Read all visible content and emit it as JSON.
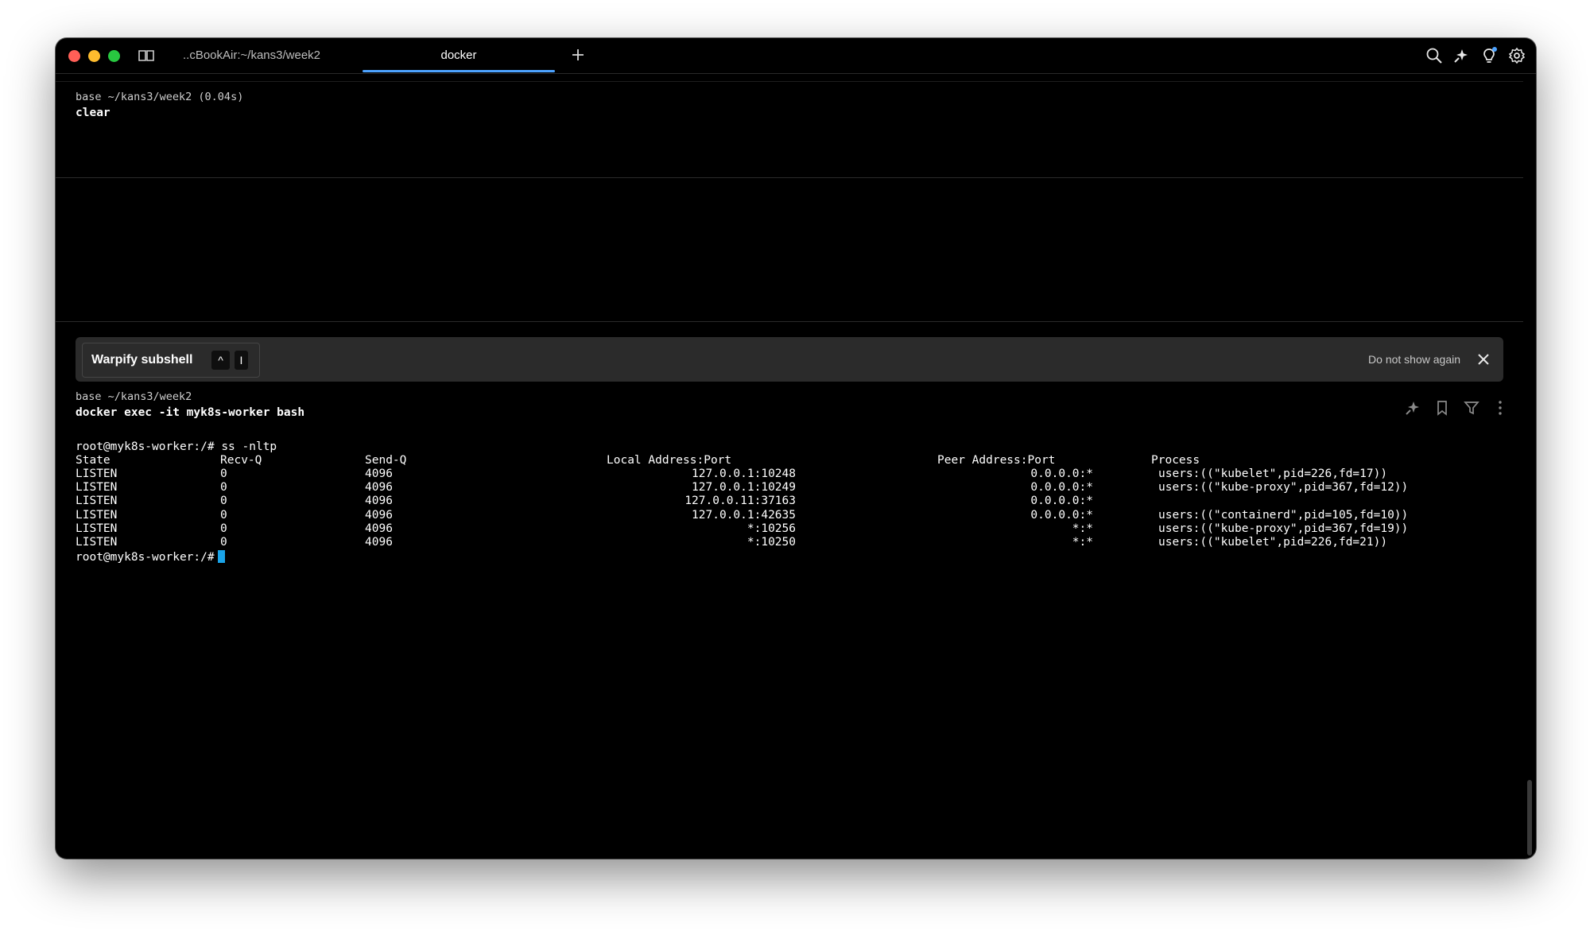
{
  "titlebar": {
    "tab1_label": "..cBookAir:~/kans3/week2",
    "tab2_label": "docker",
    "notification_color": "#4da3ff"
  },
  "block1": {
    "dir": "base ~/kans3/week2 (0.04s)",
    "command": "clear"
  },
  "banner": {
    "title": "Warpify subshell",
    "key1": "^",
    "key2": "I",
    "dismiss": "Do not show again"
  },
  "block2": {
    "dir": "base ~/kans3/week2",
    "command": "docker exec -it myk8s-worker bash"
  },
  "terminal": {
    "prompt_cmd": "root@myk8s-worker:/# ss -nltp",
    "prompt": "root@myk8s-worker:/#",
    "headers": [
      "State",
      "Recv-Q",
      "Send-Q",
      "Local Address:Port",
      "Peer Address:Port",
      "Process"
    ],
    "rows": [
      [
        "LISTEN",
        "0",
        "4096",
        "127.0.0.1:10248",
        "0.0.0.0:*",
        "users:((\"kubelet\",pid=226,fd=17))"
      ],
      [
        "LISTEN",
        "0",
        "4096",
        "127.0.0.1:10249",
        "0.0.0.0:*",
        "users:((\"kube-proxy\",pid=367,fd=12))"
      ],
      [
        "LISTEN",
        "0",
        "4096",
        "127.0.0.11:37163",
        "0.0.0.0:*",
        ""
      ],
      [
        "LISTEN",
        "0",
        "4096",
        "127.0.0.1:42635",
        "0.0.0.0:*",
        "users:((\"containerd\",pid=105,fd=10))"
      ],
      [
        "LISTEN",
        "0",
        "4096",
        "*:10256",
        "*:*",
        "users:((\"kube-proxy\",pid=367,fd=19))"
      ],
      [
        "LISTEN",
        "0",
        "4096",
        "*:10250",
        "*:*",
        "users:((\"kubelet\",pid=226,fd=21))"
      ]
    ]
  },
  "colors": {
    "background": "#000000",
    "tab_underline": "#4da3ff",
    "cursor": "#1aa3e8"
  }
}
